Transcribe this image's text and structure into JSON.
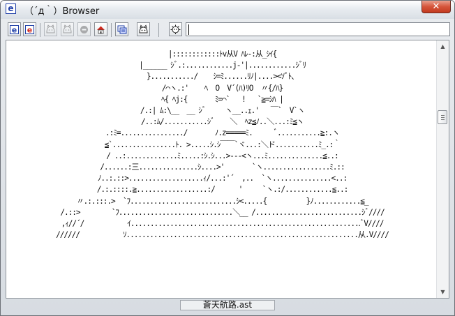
{
  "window": {
    "title": "（´д｀）Browser",
    "app_icon_glyph": "e",
    "close_glyph": "✕"
  },
  "toolbar": {
    "buttons": [
      {
        "icon": "ie-icon",
        "glyph": "e",
        "enabled": true
      },
      {
        "icon": "ie-red-icon",
        "glyph": "e",
        "enabled": true
      },
      {
        "icon": "back-face-icon",
        "glyph": "🐈",
        "enabled": false
      },
      {
        "icon": "forward-face-icon",
        "glyph": "🐈",
        "enabled": false
      },
      {
        "icon": "stop-icon",
        "glyph": "●",
        "enabled": false
      },
      {
        "icon": "home-icon",
        "glyph": "⌂",
        "enabled": true
      },
      {
        "icon": "favorites-icon",
        "glyph": "▣",
        "enabled": true
      },
      {
        "icon": "face-icon",
        "glyph": "ᗢ",
        "enabled": true
      },
      {
        "icon": "settings-face-icon",
        "glyph": "✺",
        "enabled": true
      }
    ],
    "address_value": ""
  },
  "content": {
    "ascii_art": "|::::::::::::ﾄv从V ﾊﾚ-:从_ｼｲ{\n|______ ｼﾞ.:............j-'|............ｼﾞﾘ\n}.........../    ｼ=ﾐ......ﾘﾉ|....><ｿﾟﾄ、\n/⌒ヽ.:'    ﾍ  O  V´(ﾊ)ﾘO  〃{/ﾊ}\nﾍ{ ﾍj:{       ﾐ=⌒`   !   `≧=ｼﾊ |\n/.:| ﾑ:\\__  __ ｼﾞ     ヽ__..ｪ.'   ￣`  V`ヽ\n/..:ﾑ/...........ｼﾞ    ＼  ﾍz≦ﾉ..＼...:ﾐ≦ヽ\n.:ﾐ=................/       ﾉ.z=====ﾐ.      ﾞ...........≧:.ヽ\n≦`................ﾄ. >.....ｼ.ｼ￣￣`ヾ...:＼ド...........ﾐ_.:｀\n/ ..:.............ﾐ.....:ｼ.ｼ...>-‐-<ヽ...ﾐ..............≦..:\n/......:三...............ｼ....>'       `ヽ.................ﾐ.::\nﾉ..:.::>...................ｨ/...:'´  ,..  `ヽ...............<..:\n/.:.::::.≧..................:/      '     `ヽ.:/............≦..:\n〃.:.:::.>  `ﾌ...........................ｼ<.....{          }ﾉ............≦_\n/.::>        `ﾌ.............................＼__ /...........................ｼﾞ////\n,ｨ//´/           ｲ...........................................................ﾞV////\n//////           ｿ...........................................................从.V////"
  },
  "status": {
    "text": "蒼天航路.ast"
  }
}
